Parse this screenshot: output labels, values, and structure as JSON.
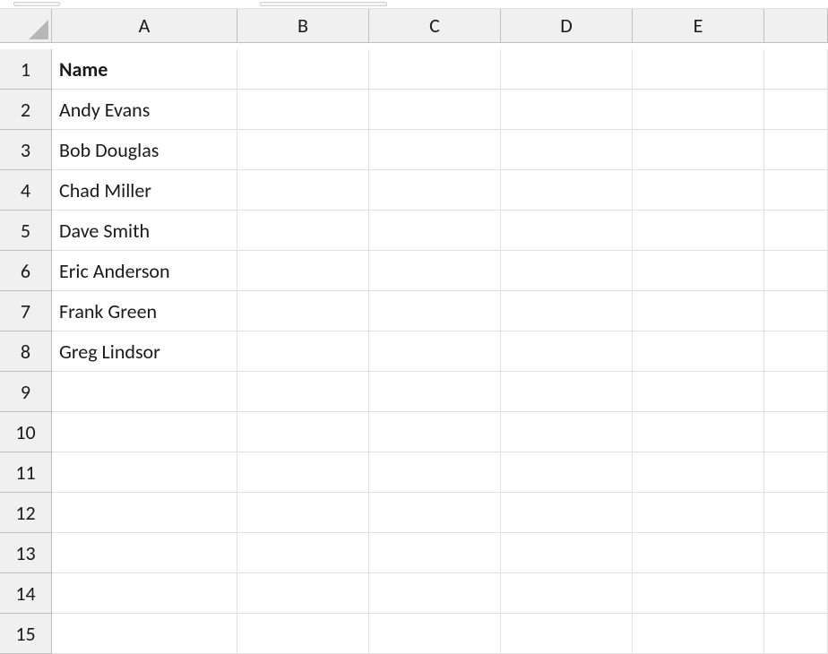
{
  "columns": [
    "A",
    "B",
    "C",
    "D",
    "E",
    ""
  ],
  "rows": [
    "1",
    "2",
    "3",
    "4",
    "5",
    "6",
    "7",
    "8",
    "9",
    "10",
    "11",
    "12",
    "13",
    "14",
    "15"
  ],
  "cells": {
    "A1": {
      "value": "Name",
      "bold": true
    },
    "A2": {
      "value": "Andy Evans"
    },
    "A3": {
      "value": "Bob Douglas"
    },
    "A4": {
      "value": "Chad Miller"
    },
    "A5": {
      "value": "Dave Smith"
    },
    "A6": {
      "value": "Eric Anderson"
    },
    "A7": {
      "value": "Frank Green"
    },
    "A8": {
      "value": "Greg Lindsor"
    }
  },
  "chart_data": {
    "type": "table",
    "columns": [
      "Name"
    ],
    "rows": [
      [
        "Andy Evans"
      ],
      [
        "Bob Douglas"
      ],
      [
        "Chad Miller"
      ],
      [
        "Dave Smith"
      ],
      [
        "Eric Anderson"
      ],
      [
        "Frank Green"
      ],
      [
        "Greg Lindsor"
      ]
    ]
  }
}
